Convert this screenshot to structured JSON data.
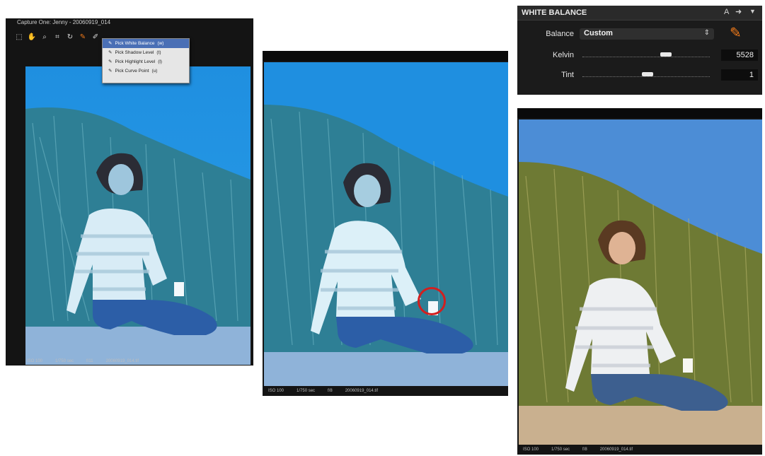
{
  "window1": {
    "title": "Capture One: Jenny - 20060919_014",
    "menu": {
      "items": [
        {
          "label": "Pick White Balance",
          "shortcut": "(w)"
        },
        {
          "label": "Pick Shadow Level",
          "shortcut": "(t)"
        },
        {
          "label": "Pick Highlight Level",
          "shortcut": "(l)"
        },
        {
          "label": "Pick Curve Point",
          "shortcut": "(u)"
        }
      ]
    },
    "status": {
      "iso": "ISO 100",
      "shutter": "1/750 sec",
      "aperture": "f/11",
      "filename": "20060919_014.tif"
    }
  },
  "window2": {
    "status": {
      "iso": "ISO 100",
      "shutter": "1/750 sec",
      "aperture": "f/8",
      "filename": "20060919_014.tif"
    }
  },
  "wb_panel": {
    "title": "WHITE BALANCE",
    "header_letter": "A",
    "balance_label": "Balance",
    "balance_value": "Custom",
    "kelvin_label": "Kelvin",
    "kelvin_value": "5528",
    "tint_label": "Tint",
    "tint_value": "1"
  },
  "window3": {
    "status": {
      "iso": "ISO 100",
      "shutter": "1/750 sec",
      "aperture": "f/8",
      "filename": "20060919_014.tif"
    }
  },
  "colors": {
    "tint_blue": "#1f8fe0",
    "accent_orange": "#f07a1a",
    "menu_selected": "#4a6fb5"
  }
}
